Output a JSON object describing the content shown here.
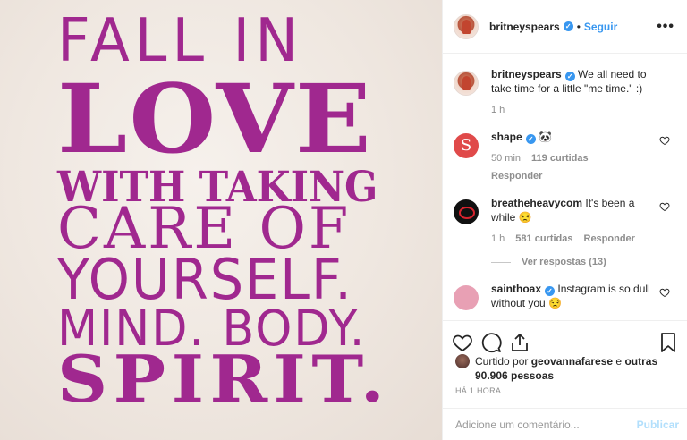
{
  "post": {
    "image_text": {
      "line1": "FALL IN",
      "line2": "LOVE",
      "line3": "WITH TAKING",
      "line4": "CARE OF",
      "line5": "YOURSELF.",
      "line6": "MIND. BODY.",
      "line7": "SPIRIT."
    },
    "accent_color": "#a0288f"
  },
  "header": {
    "username": "britneyspears",
    "dot": "•",
    "follow_label": "Seguir",
    "more_label": "•••"
  },
  "caption": {
    "username": "britneyspears",
    "text": "We all need to take time for a little \"me time.\" :)",
    "time": "1 h"
  },
  "comments": [
    {
      "username": "shape",
      "text": "🐼",
      "time": "50 min",
      "likes": "119 curtidas",
      "reply": "Responder",
      "avatar_letter": "S"
    },
    {
      "username": "breatheheavycom",
      "text": "It's been a while 😒",
      "time": "1 h",
      "likes": "581 curtidas",
      "reply": "Responder"
    },
    {
      "username": "sainthoax",
      "text": "Instagram is so dull without you 😒"
    }
  ],
  "view_replies": "Ver respostas (13)",
  "likes": {
    "prefix": "Curtido por ",
    "user": "geovannafarese",
    "middle": " e ",
    "others": "outras 90.906 pessoas"
  },
  "timestamp": "HÁ 1 HORA",
  "comment_box": {
    "placeholder": "Adicione um comentário...",
    "publish_label": "Publicar"
  },
  "icons": [
    "heart-icon",
    "comment-icon",
    "share-icon",
    "bookmark-icon",
    "more-icon",
    "verified-icon"
  ]
}
